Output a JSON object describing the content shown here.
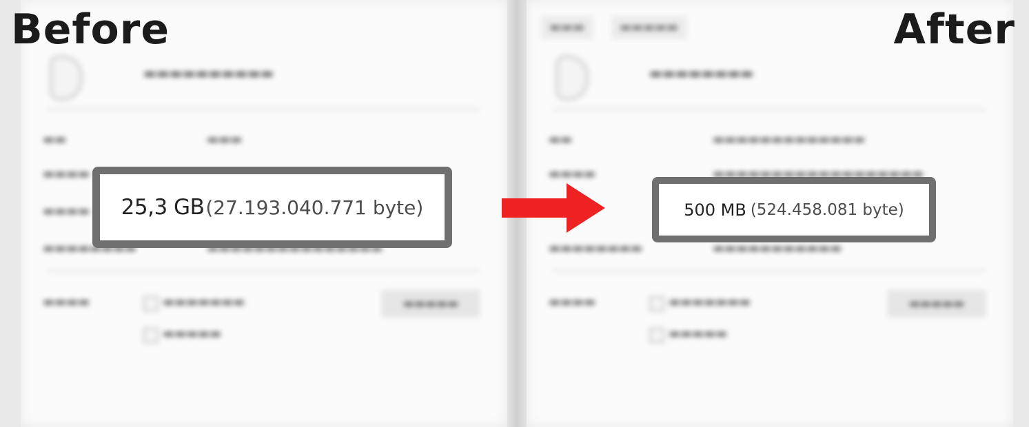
{
  "headings": {
    "before": "Before",
    "after": "After"
  },
  "before": {
    "size_main": "25,3 GB",
    "size_bytes": "(27.193.040.771 byte)"
  },
  "after": {
    "size_main": "500 MB",
    "size_bytes": "(524.458.081 byte)"
  },
  "arrow_color": "#ee2222"
}
